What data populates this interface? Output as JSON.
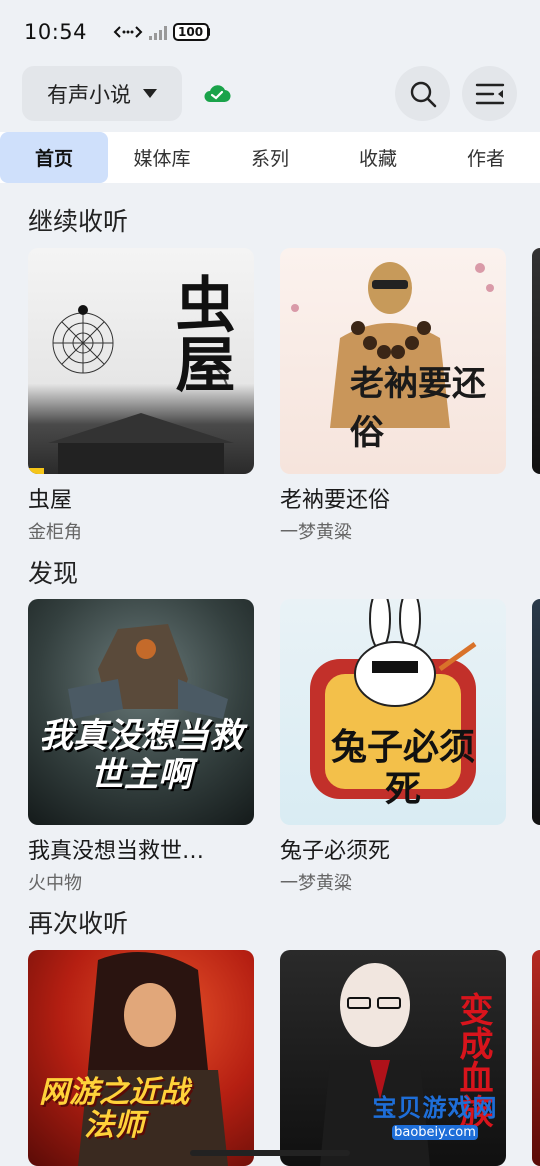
{
  "status_bar": {
    "time": "10:54",
    "battery": "100"
  },
  "header": {
    "library_label": "有声小说"
  },
  "tabs": [
    {
      "label": "首页",
      "active": true
    },
    {
      "label": "媒体库",
      "active": false
    },
    {
      "label": "系列",
      "active": false
    },
    {
      "label": "收藏",
      "active": false
    },
    {
      "label": "作者",
      "active": false
    }
  ],
  "sections": {
    "continue": {
      "title": "继续收听",
      "books": [
        {
          "title": "虫屋",
          "author": "金柜角",
          "cover_text": "虫屋"
        },
        {
          "title": "老衲要还俗",
          "author": "一梦黄粱",
          "cover_text": "老衲要还俗"
        }
      ]
    },
    "discover": {
      "title": "发现",
      "books": [
        {
          "title": "我真没想当救世…",
          "author": "火中物",
          "cover_text": "我真没想当救世主啊"
        },
        {
          "title": "兔子必须死",
          "author": "一梦黄粱",
          "cover_text": "兔子必须死"
        }
      ]
    },
    "relisten": {
      "title": "再次收听",
      "books": [
        {
          "title": "",
          "author": "",
          "cover_text": "网游之近战法师"
        },
        {
          "title": "",
          "author": "",
          "cover_text": "变成血族"
        }
      ]
    }
  },
  "watermark": {
    "line1": "宝贝游戏网",
    "line2": "baobeiy.com"
  },
  "colors": {
    "accent_tab": "#cfe0fb",
    "cloud": "#1aa34a",
    "watermark": "#1e6ed8"
  }
}
